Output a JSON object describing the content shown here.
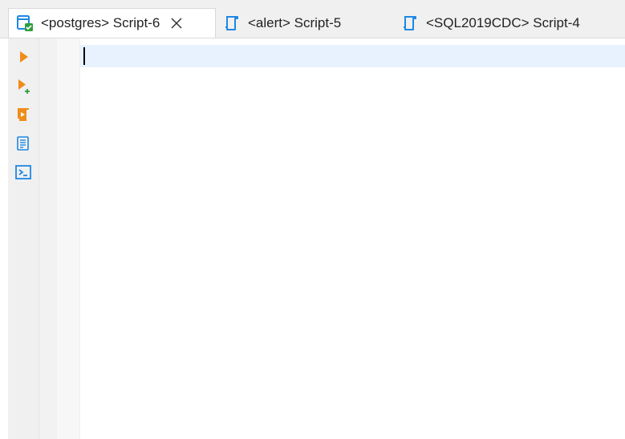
{
  "tabs": [
    {
      "label": "<postgres> Script-6",
      "active": true,
      "icon": "script-connected-icon",
      "closable": true
    },
    {
      "label": "<alert> Script-5",
      "active": false,
      "icon": "script-icon"
    },
    {
      "label": "<SQL2019CDC> Script-4",
      "active": false,
      "icon": "script-icon"
    }
  ],
  "toolbar": [
    {
      "name": "execute-statement-button",
      "icon": "play-icon"
    },
    {
      "name": "execute-new-tab-button",
      "icon": "play-plus-icon"
    },
    {
      "name": "execute-script-button",
      "icon": "script-run-icon"
    },
    {
      "name": "explain-plan-button",
      "icon": "document-list-icon"
    },
    {
      "name": "open-output-button",
      "icon": "terminal-icon"
    }
  ],
  "colors": {
    "accent_blue": "#1e88e5",
    "accent_orange": "#f08c1a",
    "current_line": "#e8f2fe",
    "green_check": "#2e9e3e"
  },
  "editor": {
    "content": ""
  }
}
